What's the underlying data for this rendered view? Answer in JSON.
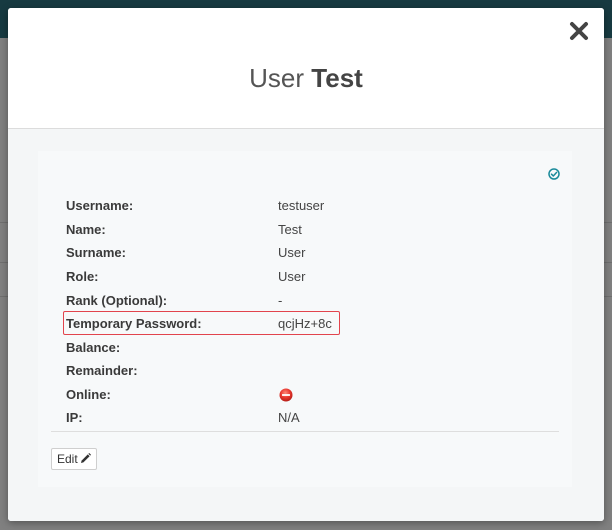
{
  "modal": {
    "title_prefix": "User",
    "title_bold": "Test"
  },
  "user_info": {
    "rows": [
      {
        "label": "Username:",
        "value": "testuser"
      },
      {
        "label": "Name:",
        "value": "Test"
      },
      {
        "label": "Surname:",
        "value": "User"
      },
      {
        "label": "Role:",
        "value": "User"
      },
      {
        "label": "Rank (Optional):",
        "value": "-"
      },
      {
        "label": "Temporary Password:",
        "value": "qcjHz+8c"
      },
      {
        "label": "Balance:",
        "value": ""
      },
      {
        "label": "Remainder:",
        "value": ""
      },
      {
        "label": "Online:",
        "value": ""
      },
      {
        "label": "IP:",
        "value": "N/A"
      }
    ],
    "online_status": "offline"
  },
  "actions": {
    "edit_label": "Edit"
  },
  "icons": {
    "close": "close-icon",
    "verified": "check-circle-icon",
    "online_status": "red-status-dot-icon",
    "edit": "pencil-icon"
  },
  "colors": {
    "accent": "#1a8a9a",
    "highlight_border": "#e2444d",
    "offline_dot": "#e8382f",
    "topbar": "#173a41"
  }
}
